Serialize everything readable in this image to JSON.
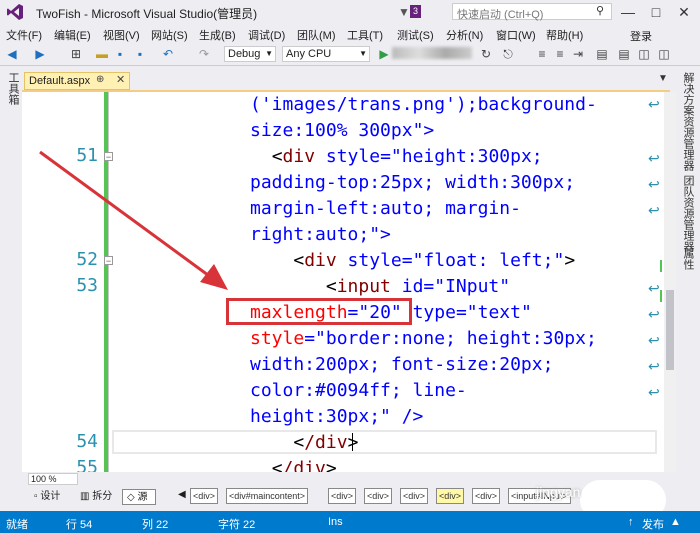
{
  "window": {
    "title": "TwoFish - Microsoft Visual Studio(管理员)",
    "notification_count": "3",
    "quick_launch_placeholder": "快速启动 (Ctrl+Q)",
    "min_glyph": "—",
    "max_glyph": "□",
    "close_glyph": "✕"
  },
  "menu": {
    "items": [
      "文件(F)",
      "编辑(E)",
      "视图(V)",
      "网站(S)",
      "生成(B)",
      "调试(D)",
      "团队(M)",
      "工具(T)",
      "测试(S)",
      "分析(N)",
      "窗口(W)",
      "帮助(H)"
    ],
    "login": "登录"
  },
  "toolbar": {
    "config": "Debug",
    "platform": "Any CPU"
  },
  "side": {
    "left_label": "工具箱",
    "right_labels": [
      "解决方案资源管理器",
      "团队资源管理器",
      "属性"
    ]
  },
  "tab": {
    "label": "Default.aspx",
    "pin": "⊕",
    "close": "✕"
  },
  "editor": {
    "line_numbers": [
      "51",
      "52",
      "53",
      "54",
      "55"
    ],
    "lines": [
      [
        "('images/trans.png');background-"
      ],
      [
        "size:100% 300px\">"
      ],
      [
        "  <div style=\"height:300px;"
      ],
      [
        "padding-top:25px; width:300px;"
      ],
      [
        "margin-left:auto; margin-"
      ],
      [
        "right:auto;\">"
      ],
      [
        "    <div style=\"float: left;\">"
      ],
      [
        "       <input id=\"INput\""
      ],
      [
        "maxlength=\"20\" type=\"text\""
      ],
      [
        "style=\"border:none; height:30px;"
      ],
      [
        "width:200px; font-size:20px;"
      ],
      [
        "color:#0094ff; line-"
      ],
      [
        "height:30px;\" />"
      ],
      [
        "    </div>"
      ],
      [
        "  </div>"
      ]
    ]
  },
  "zoom": "100 %",
  "bottom_bar": {
    "design": "设计",
    "split": "拆分",
    "source": "源",
    "crumbs": [
      "<div>",
      "<div#maincontent>",
      "<div>",
      "<div>",
      "<div>",
      "<div>",
      "<div>",
      "<input#INput>"
    ]
  },
  "status": {
    "ready": "就绪",
    "line": "行 54",
    "col": "列 22",
    "char": "字符 22",
    "ins": "Ins",
    "publish": "发布"
  },
  "watermark": "jingyan"
}
